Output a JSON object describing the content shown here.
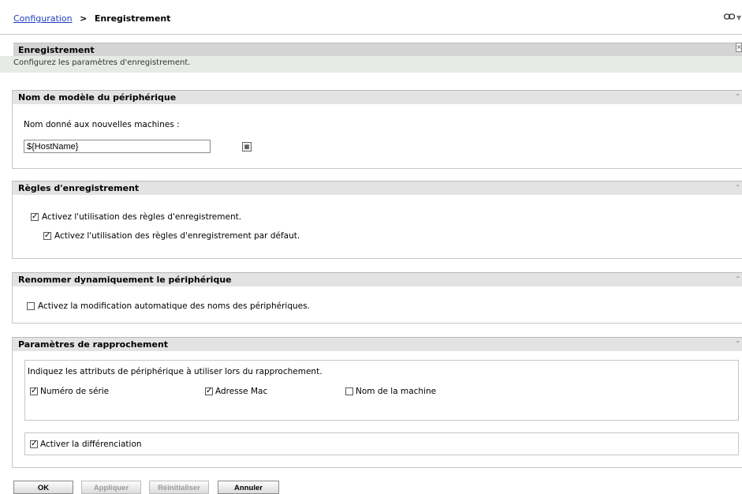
{
  "breadcrumb": {
    "parent": "Configuration",
    "separator": ">",
    "current": "Enregistrement"
  },
  "header": {
    "title": "Enregistrement",
    "description": "Configurez les paramètres d'enregistrement.",
    "close_glyph": "×"
  },
  "icons": {
    "link": "link-icon",
    "collapse": "double-chevron-up-icon",
    "browse": "browse-icon",
    "check": "✓"
  },
  "sections": {
    "device_name": {
      "title": "Nom de modèle du périphérique",
      "label": "Nom donné aux nouvelles machines :",
      "value": "${HostName}"
    },
    "rules": {
      "title": "Règles d'enregistrement",
      "enable_rules": {
        "label": "Activez l'utilisation des règles d'enregistrement.",
        "checked": true
      },
      "enable_default_rules": {
        "label": "Activez l'utilisation des règles d'enregistrement par défaut.",
        "checked": true
      }
    },
    "rename": {
      "title": "Renommer dynamiquement le périphérique",
      "enable_rename": {
        "label": "Activez la modification automatique des noms des périphériques.",
        "checked": false
      }
    },
    "reconcile": {
      "title": "Paramètres de rapprochement",
      "instructions": "Indiquez les attributs de périphérique à utiliser lors du rapprochement.",
      "serial": {
        "label": "Numéro de série",
        "checked": true
      },
      "mac": {
        "label": "Adresse Mac",
        "checked": true
      },
      "machine_name": {
        "label": "Nom de la machine",
        "checked": false
      },
      "differentiation": {
        "label": "Activer la différenciation",
        "checked": true
      }
    }
  },
  "buttons": {
    "ok": "OK",
    "apply": "Appliquer",
    "reset": "Réinitialiser",
    "cancel": "Annuler"
  }
}
